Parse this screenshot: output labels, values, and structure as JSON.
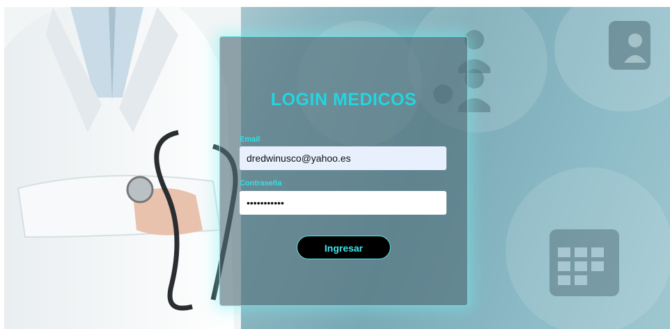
{
  "login": {
    "title": "LOGIN MEDICOS",
    "email_label": "Email",
    "email_value": "dredwinusco@yahoo.es",
    "password_label": "Contraseña",
    "password_value": "•••••••••••",
    "submit_label": "Ingresar"
  },
  "colors": {
    "accent": "#22d6e0",
    "button_bg": "#000000",
    "card_border": "#6fe3e6"
  },
  "icons": [
    "doctor-photo-image",
    "people-icon",
    "heart-icon",
    "calendar-icon",
    "users-list-icon"
  ]
}
